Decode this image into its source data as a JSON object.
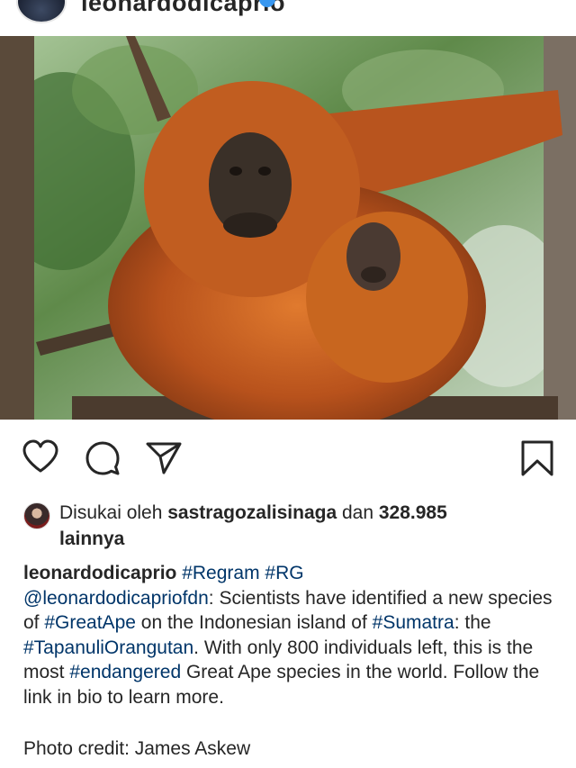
{
  "post": {
    "username": "leonardodicaprio",
    "verified": true
  },
  "icons": {
    "like": "heart-icon",
    "comment": "comment-icon",
    "share": "send-icon",
    "save": "bookmark-icon"
  },
  "likes": {
    "prefix": "Disukai oleh ",
    "liker": "sastragozalisinaga",
    "middle": " dan ",
    "count": "328.985",
    "suffix": "lainnya"
  },
  "caption": {
    "author": "leonardodicaprio",
    "tag_regram": "#Regram",
    "tag_rg": "#RG",
    "mention": "@leonardodicapriofdn",
    "t1": ": Scientists have identified a new species of ",
    "tag_greatape": "#GreatApe",
    "t2": " on the Indonesian island of ",
    "tag_sumatra": "#Sumatra",
    "t3": ": the ",
    "tag_tapanuli": "#TapanuliOrangutan",
    "t4": ". With only 800 individuals left, this is the most ",
    "tag_endangered": "#endangered",
    "t5": " Great Ape species in the world. Follow the link in bio to learn more."
  },
  "credit": "Photo credit: James Askew",
  "colors": {
    "link": "#003569",
    "text": "#262626",
    "verified": "#3897f0"
  }
}
